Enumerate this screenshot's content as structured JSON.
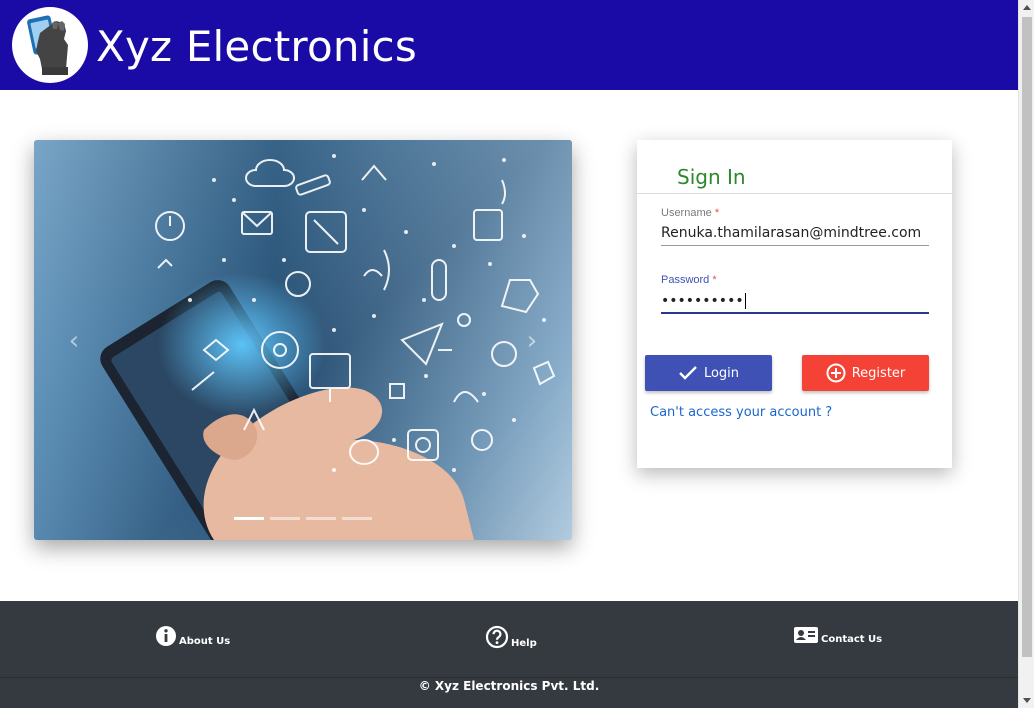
{
  "header": {
    "brand": "Xyz Electronics",
    "color": "#1a0ba6"
  },
  "carousel": {
    "prev_icon": "chevron-left-icon",
    "next_icon": "chevron-right-icon",
    "slide_count": 4,
    "active_slide": 1
  },
  "signin": {
    "title": "Sign In",
    "username_label": "Username",
    "username_value": "Renuka.thamilarasan@mindtree.com",
    "password_label": "Password",
    "password_value": "••••••••••",
    "required_marker": "*",
    "login_label": "Login",
    "register_label": "Register",
    "forgot_link": "Can't access your account ?",
    "title_color": "#2a8a2a",
    "login_color": "#3f51b5",
    "register_color": "#f44336"
  },
  "footer": {
    "about_label": "About Us",
    "help_label": "Help",
    "contact_label": "Contact Us",
    "copyright": "© Xyz Electronics Pvt. Ltd.",
    "color": "#343a40"
  }
}
